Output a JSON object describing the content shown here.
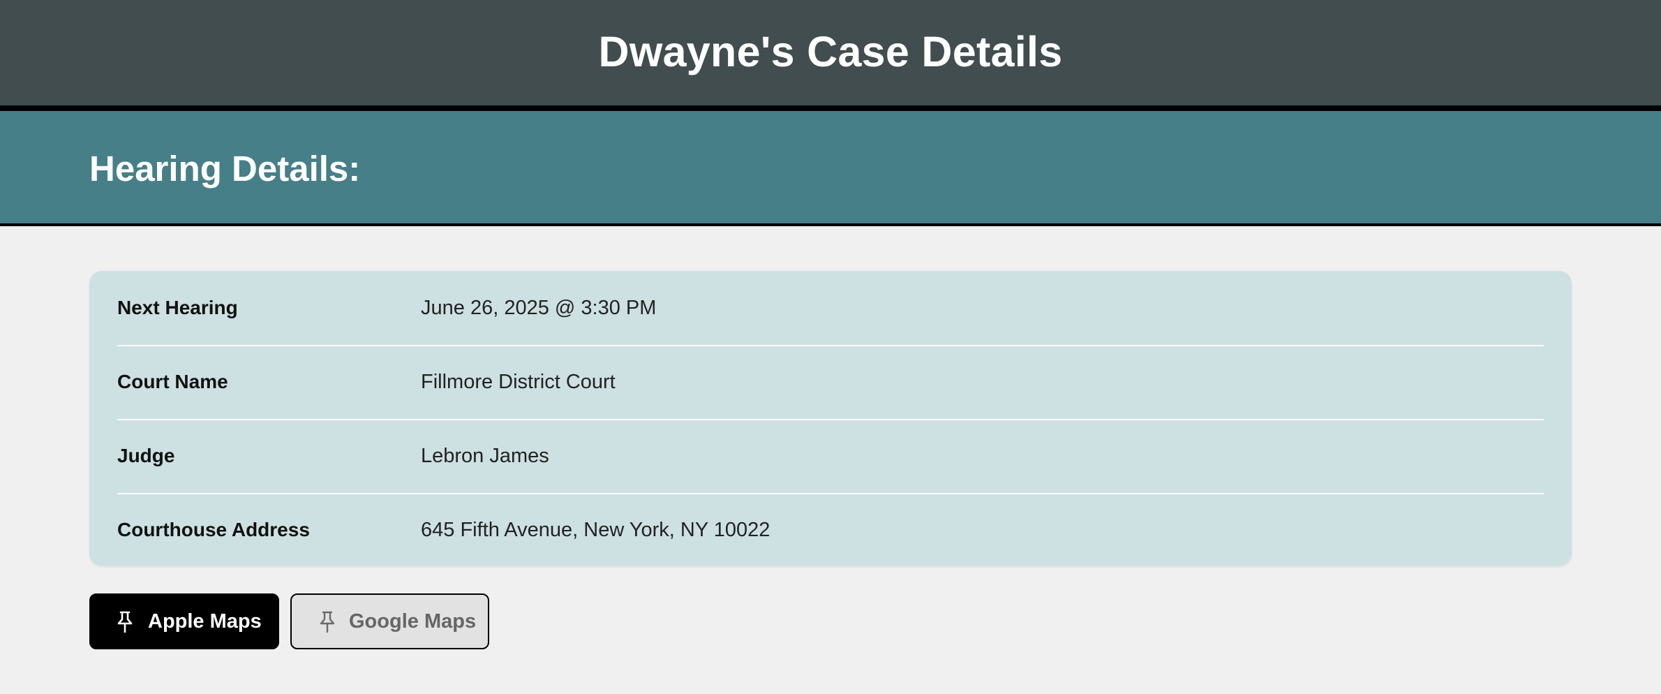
{
  "header": {
    "title": "Dwayne's Case Details"
  },
  "section": {
    "title": "Hearing Details:"
  },
  "details": [
    {
      "label": "Next Hearing",
      "value": "June 26, 2025 @ 3:30 PM"
    },
    {
      "label": "Court Name",
      "value": "Fillmore District Court"
    },
    {
      "label": "Judge",
      "value": "Lebron James"
    },
    {
      "label": "Courthouse Address",
      "value": "645 Fifth Avenue, New York, NY 10022"
    }
  ],
  "actions": {
    "apple_maps": {
      "label": "Apple Maps",
      "icon": "pin-icon"
    },
    "google_maps": {
      "label": "Google Maps",
      "icon": "pin-icon"
    }
  },
  "colors": {
    "header_bg": "#414d4e",
    "section_bg": "#467f88",
    "card_bg": "#cde0e2",
    "page_bg": "#f0f0f0"
  }
}
